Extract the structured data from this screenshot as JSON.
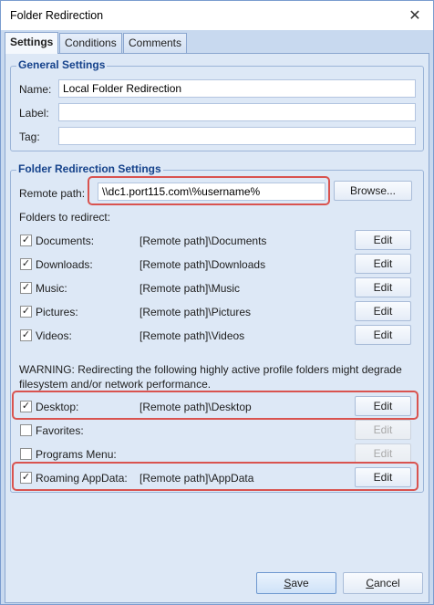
{
  "window": {
    "title": "Folder Redirection",
    "close_glyph": "✕"
  },
  "tabs": [
    {
      "label": "Settings",
      "active": true
    },
    {
      "label": "Conditions",
      "active": false
    },
    {
      "label": "Comments",
      "active": false
    }
  ],
  "general": {
    "title": "General Settings",
    "name_label": "Name:",
    "name_value": "Local Folder Redirection",
    "label_label": "Label:",
    "label_value": "",
    "tag_label": "Tag:",
    "tag_value": ""
  },
  "redirect": {
    "title": "Folder Redirection Settings",
    "remote_path_label": "Remote path:",
    "remote_path_value": "\\\\dc1.port115.com\\%username%",
    "browse_label": "Browse...",
    "folders_label": "Folders to redirect:",
    "folders": [
      {
        "label": "Documents:",
        "path": "[Remote path]\\Documents",
        "checked": true,
        "edit": "Edit",
        "enabled": true
      },
      {
        "label": "Downloads:",
        "path": "[Remote path]\\Downloads",
        "checked": true,
        "edit": "Edit",
        "enabled": true
      },
      {
        "label": "Music:",
        "path": "[Remote path]\\Music",
        "checked": true,
        "edit": "Edit",
        "enabled": true
      },
      {
        "label": "Pictures:",
        "path": "[Remote path]\\Pictures",
        "checked": true,
        "edit": "Edit",
        "enabled": true
      },
      {
        "label": "Videos:",
        "path": "[Remote path]\\Videos",
        "checked": true,
        "edit": "Edit",
        "enabled": true
      }
    ],
    "warning_line1": "WARNING: Redirecting the following highly active profile folders might degrade",
    "warning_line2": "filesystem and/or network performance.",
    "active_folders": [
      {
        "label": "Desktop:",
        "path": "[Remote path]\\Desktop",
        "checked": true,
        "edit": "Edit",
        "enabled": true
      },
      {
        "label": "Favorites:",
        "path": "",
        "checked": false,
        "edit": "Edit",
        "enabled": false
      },
      {
        "label": "Programs Menu:",
        "path": "",
        "checked": false,
        "edit": "Edit",
        "enabled": false
      },
      {
        "label": "Roaming AppData:",
        "path": "[Remote path]\\AppData",
        "checked": true,
        "edit": "Edit",
        "enabled": true
      }
    ]
  },
  "footer": {
    "save_label": "Save",
    "save_key": "S",
    "save_rest": "ave",
    "cancel_label": "Cancel",
    "cancel_key": "C",
    "cancel_rest": "ancel"
  },
  "colors": {
    "highlight": "#d9534f",
    "group_title": "#15428b",
    "panel_bg": "#dde8f6"
  },
  "icons": {
    "check": "✓"
  }
}
